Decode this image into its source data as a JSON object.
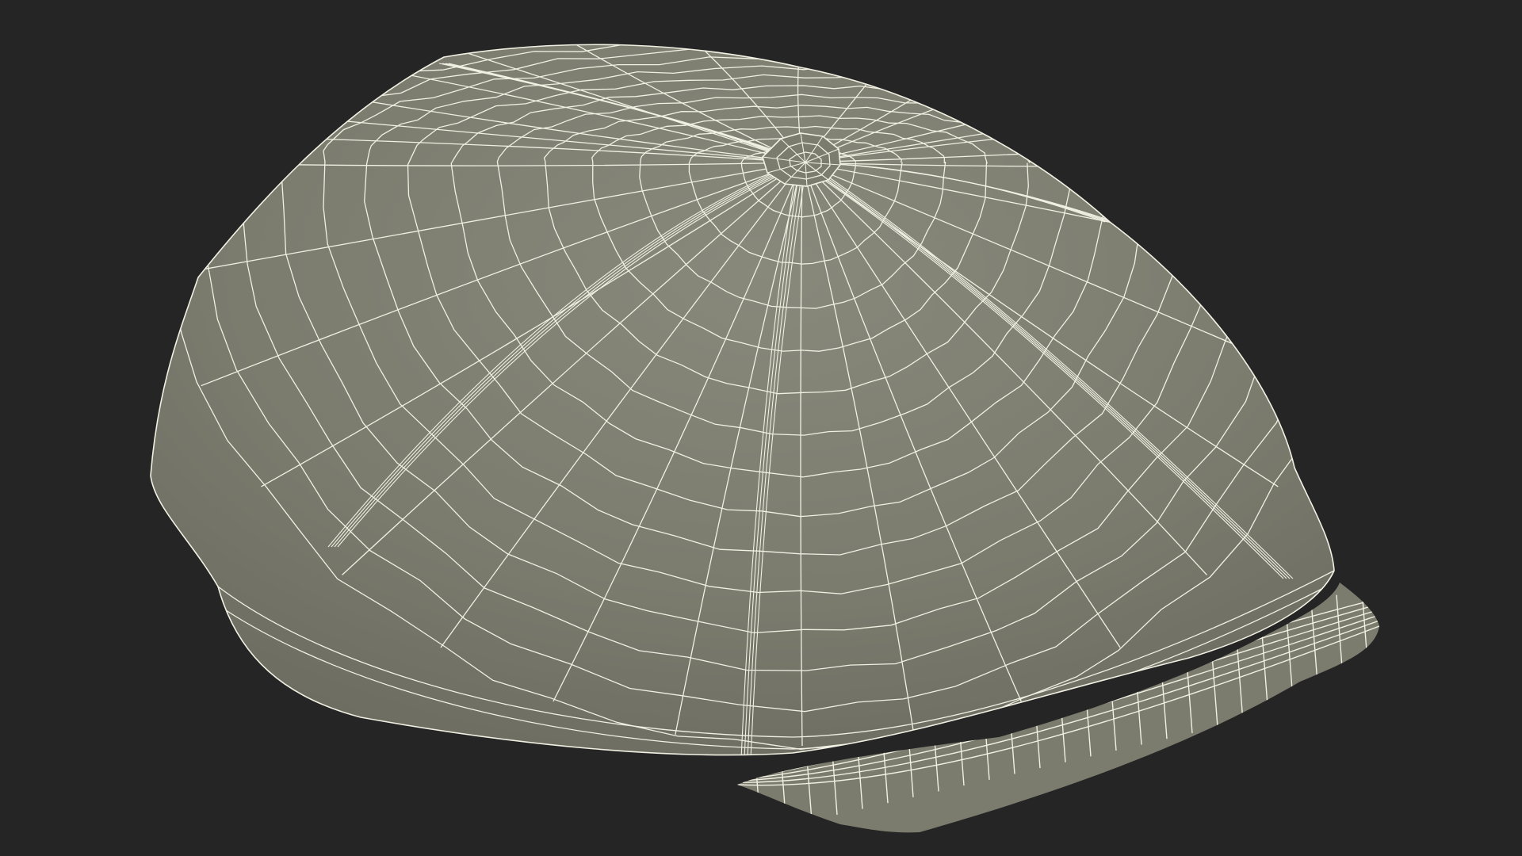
{
  "scene": {
    "background_color": "#252525",
    "surface_color": "#7b7b6e",
    "surface_shadow_color": "#6b6b60",
    "surface_light_color": "#88887b",
    "wire_color": "#f1f0e3"
  }
}
